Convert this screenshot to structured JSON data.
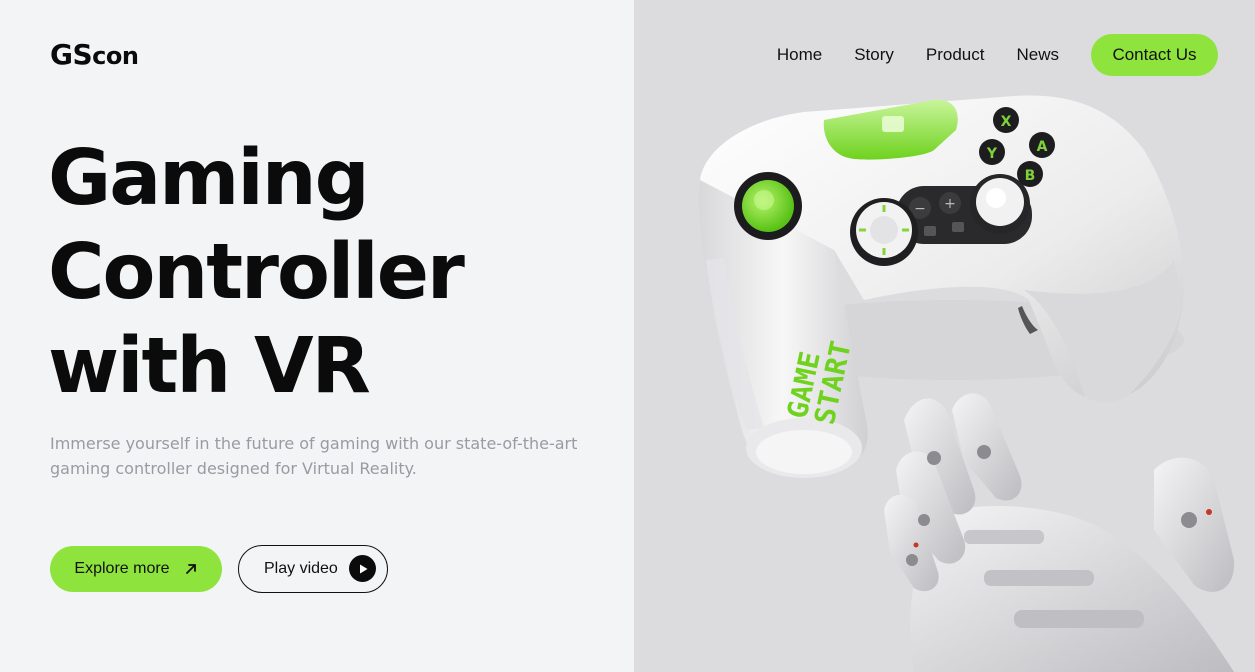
{
  "logo": {
    "big": "GS",
    "small": "con"
  },
  "nav": {
    "items": [
      {
        "label": "Home"
      },
      {
        "label": "Story"
      },
      {
        "label": "Product"
      },
      {
        "label": "News"
      }
    ],
    "contact_label": "Contact Us"
  },
  "hero": {
    "title_lines": [
      "Gaming",
      "Controller",
      "with VR"
    ],
    "description": "Immerse yourself in the future of gaming with our state-of-the-art gaming controller designed for Virtual Reality.",
    "explore_label": "Explore more",
    "play_label": "Play video"
  },
  "image": {
    "controller_text": "GAME START"
  },
  "colors": {
    "accent": "#8ee43c",
    "text": "#0b0b0b",
    "muted": "#9a9aa2",
    "left_bg": "#f3f4f6",
    "right_bg": "#dcdcdf"
  },
  "icons": {
    "explore": "arrow-up-right-icon",
    "play": "play-icon"
  }
}
